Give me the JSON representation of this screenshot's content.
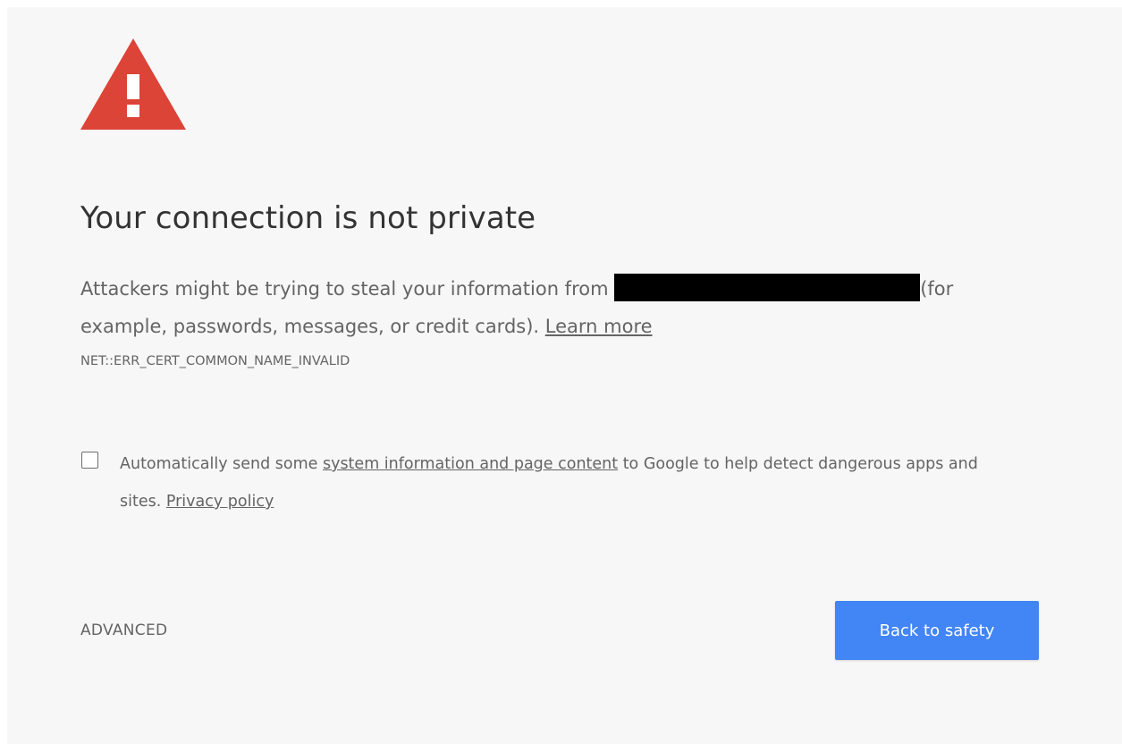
{
  "interstitial": {
    "icon": "warning-triangle-icon",
    "icon_color": "#db4437",
    "heading": "Your connection is not private",
    "message_part1": "Attackers might be trying to steal your information from ",
    "message_part2": "(for example, passwords, messages, or credit cards). ",
    "learn_more": "Learn more",
    "error_code": "NET::ERR_CERT_COMMON_NAME_INVALID",
    "optin": {
      "checked": false,
      "text_part1": "Automatically send some ",
      "system_info_link": "system information and page content",
      "text_part2": " to Google to help detect dangerous apps and sites. ",
      "privacy_link": "Privacy policy"
    },
    "advanced_label": "ADVANCED",
    "back_label": "Back to safety",
    "accent_color": "#4285f4"
  }
}
